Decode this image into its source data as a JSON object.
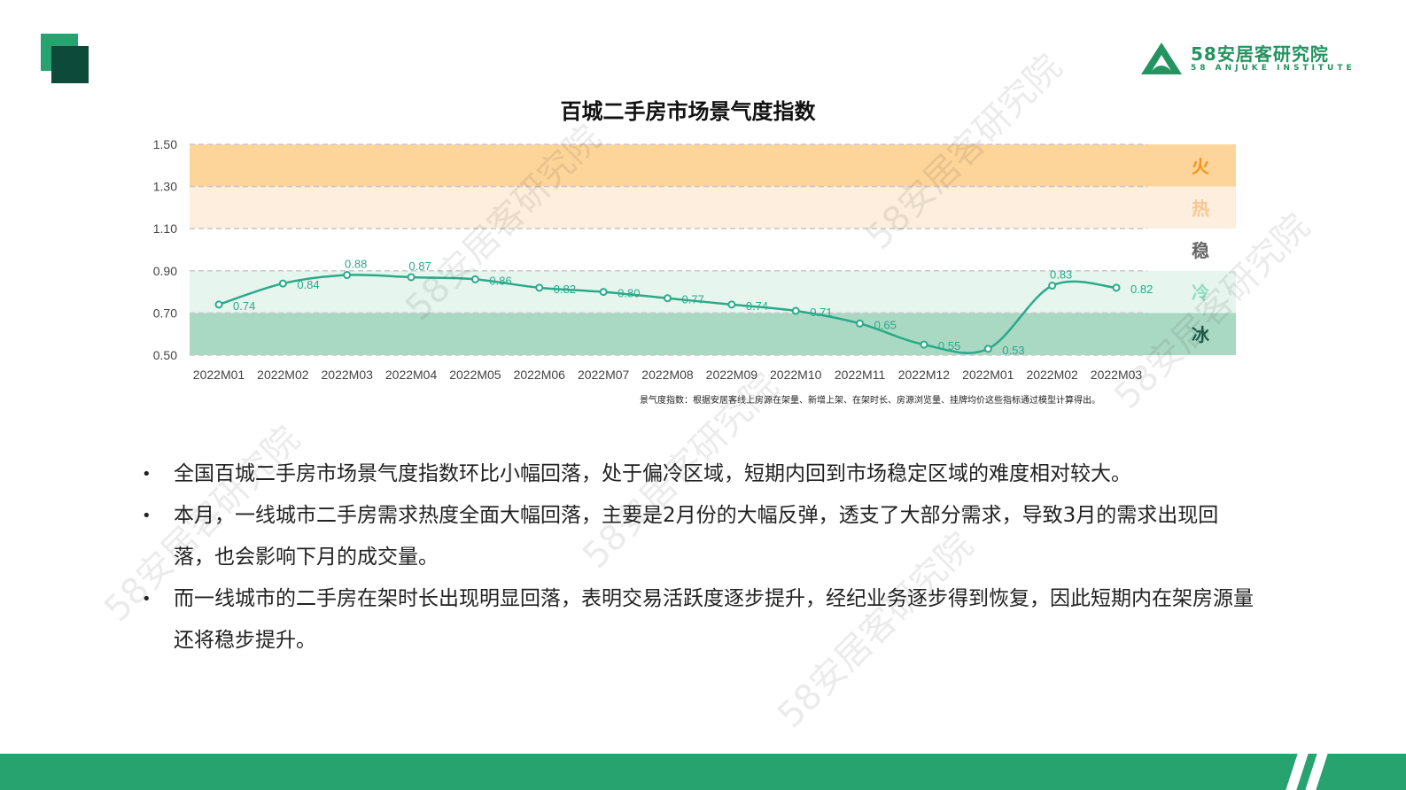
{
  "logo": {
    "cn": "58安居客研究院",
    "en": "58 ANJUKE INSTITUTE"
  },
  "watermark": "58安居客研究院",
  "chart_data": {
    "type": "line",
    "title": "百城二手房市场景气度指数",
    "categories": [
      "2022M01",
      "2022M02",
      "2022M03",
      "2022M04",
      "2022M05",
      "2022M06",
      "2022M07",
      "2022M08",
      "2022M09",
      "2022M10",
      "2022M11",
      "2022M12",
      "2022M01",
      "2022M02",
      "2022M03"
    ],
    "series": [
      {
        "name": "景气度指数",
        "values": [
          0.74,
          0.84,
          0.88,
          0.87,
          0.86,
          0.82,
          0.8,
          0.77,
          0.74,
          0.71,
          0.65,
          0.55,
          0.53,
          0.83,
          0.82
        ],
        "color": "#2aaa8a"
      }
    ],
    "ylim": [
      0.5,
      1.5
    ],
    "yticks": [
      "0.50",
      "0.70",
      "0.90",
      "1.10",
      "1.30",
      "1.50"
    ],
    "bands": [
      {
        "label": "火",
        "from": 1.3,
        "to": 1.5,
        "color": "#fdd49a",
        "text_color": "#f7931e"
      },
      {
        "label": "热",
        "from": 1.1,
        "to": 1.3,
        "color": "#fdeedd",
        "text_color": "#fbc690"
      },
      {
        "label": "稳",
        "from": 0.9,
        "to": 1.1,
        "color": "#ffffff",
        "text_color": "#666666"
      },
      {
        "label": "冷",
        "from": 0.7,
        "to": 0.9,
        "color": "#e6f5ee",
        "text_color": "#8fdcc0"
      },
      {
        "label": "冰",
        "from": 0.5,
        "to": 0.7,
        "color": "#a9d8c3",
        "text_color": "#1d5a48"
      }
    ],
    "grid": true,
    "footnote": "景气度指数：根据安居客线上房源在架量、新增上架、在架时长、房源浏览量、挂牌均价这些指标通过模型计算得出。"
  },
  "bullets": [
    "全国百城二手房市场景气度指数环比小幅回落，处于偏冷区域，短期内回到市场稳定区域的难度相对较大。",
    "本月，一线城市二手房需求热度全面大幅回落，主要是2月份的大幅反弹，透支了大部分需求，导致3月的需求出现回落，也会影响下月的成交量。",
    "而一线城市的二手房在架时长出现明显回落，表明交易活跃度逐步提升，经纪业务逐步得到恢复，因此短期内在架房源量还将稳步提升。"
  ],
  "bullet_char": "•"
}
